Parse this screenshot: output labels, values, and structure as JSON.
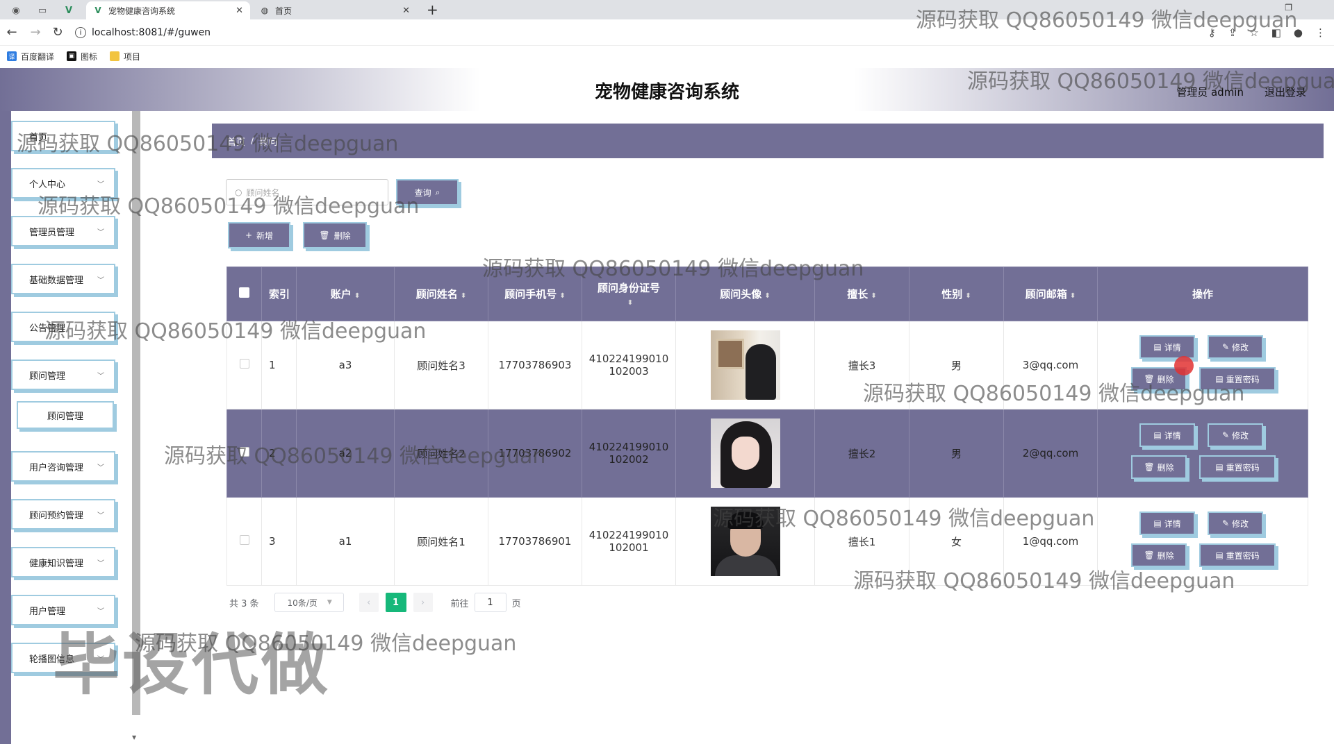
{
  "browser": {
    "tabs": [
      {
        "title": "宠物健康咨询系统",
        "active": true
      },
      {
        "title": "首页",
        "active": false
      }
    ],
    "new_tab": "+",
    "url": "localhost:8081/#/guwen",
    "bookmarks": [
      "百度翻译",
      "图标",
      "项目"
    ]
  },
  "header": {
    "title": "宠物健康咨询系统",
    "admin_label": "管理员 admin",
    "logout": "退出登录"
  },
  "sidebar": {
    "items": [
      {
        "label": "首页",
        "has_children": false
      },
      {
        "label": "个人中心",
        "has_children": true
      },
      {
        "label": "管理员管理",
        "has_children": true
      },
      {
        "label": "基础数据管理",
        "has_children": true
      },
      {
        "label": "公告管理",
        "has_children": true
      },
      {
        "label": "顾问管理",
        "has_children": true
      },
      {
        "label": "用户咨询管理",
        "has_children": true
      },
      {
        "label": "顾问预约管理",
        "has_children": true
      },
      {
        "label": "健康知识管理",
        "has_children": true
      },
      {
        "label": "用户管理",
        "has_children": true
      },
      {
        "label": "轮播图信息",
        "has_children": true
      }
    ],
    "sub_item": "顾问管理"
  },
  "breadcrumb": {
    "home": "首页",
    "current": "顾问"
  },
  "search": {
    "placeholder": "顾问姓名",
    "button": "查询"
  },
  "actions": {
    "add": "新增",
    "delete": "删除"
  },
  "table": {
    "headers": [
      "索引",
      "账户",
      "顾问姓名",
      "顾问手机号",
      "顾问身份证号",
      "顾问头像",
      "擅长",
      "性别",
      "顾问邮箱",
      "操作"
    ],
    "rows": [
      {
        "index": "1",
        "account": "a3",
        "name": "顾问姓名3",
        "phone": "17703786903",
        "id_1": "410224199010",
        "id_2": "102003",
        "skill": "擅长3",
        "gender": "男",
        "email": "3@qq.com"
      },
      {
        "index": "2",
        "account": "a2",
        "name": "顾问姓名2",
        "phone": "17703786902",
        "id_1": "410224199010",
        "id_2": "102002",
        "skill": "擅长2",
        "gender": "男",
        "email": "2@qq.com"
      },
      {
        "index": "3",
        "account": "a1",
        "name": "顾问姓名1",
        "phone": "17703786901",
        "id_1": "410224199010",
        "id_2": "102001",
        "skill": "擅长1",
        "gender": "女",
        "email": "1@qq.com"
      }
    ],
    "row_actions": {
      "detail": "详情",
      "edit": "修改",
      "delete": "删除",
      "reset": "重置密码"
    }
  },
  "pagination": {
    "total": "共 3 条",
    "page_size": "10条/页",
    "current_page": "1",
    "goto_label": "前往",
    "goto_value": "1",
    "page_unit": "页"
  },
  "watermarks": {
    "text": "源码获取 QQ86050149 微信deepguan",
    "big": "毕设代做"
  },
  "colors": {
    "accent": "#726f96",
    "border_accent": "#9fcbe0",
    "pager_active": "#16b87a"
  }
}
